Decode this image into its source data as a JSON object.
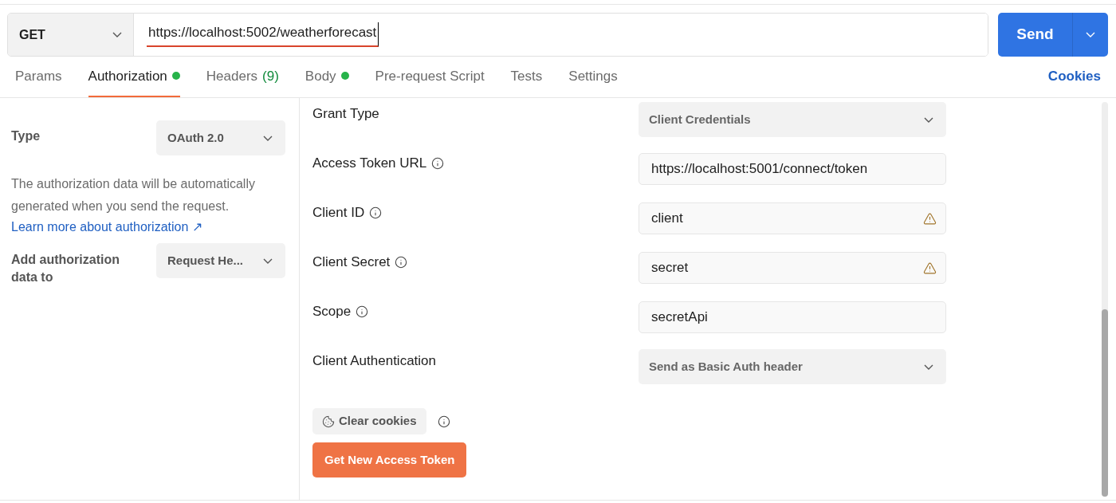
{
  "request": {
    "method": "GET",
    "url": "https://localhost:5002/weatherforecast",
    "send": "Send"
  },
  "tabs": [
    {
      "label": "Params",
      "selected": false,
      "dot": false
    },
    {
      "label": "Authorization",
      "selected": true,
      "dot": true
    },
    {
      "label": "Headers",
      "count": "(9)",
      "selected": false,
      "dot": false
    },
    {
      "label": "Body",
      "selected": false,
      "dot": true
    },
    {
      "label": "Pre-request Script",
      "selected": false,
      "dot": false
    },
    {
      "label": "Tests",
      "selected": false,
      "dot": false
    },
    {
      "label": "Settings",
      "selected": false,
      "dot": false
    }
  ],
  "cookies_link": "Cookies",
  "auth_panel": {
    "type_label": "Type",
    "type_value": "OAuth 2.0",
    "description": "The authorization data will be automatically generated when you send the request.",
    "learn_more": "Learn more about authorization ↗",
    "add_to_label": "Add authorization data to",
    "add_to_value": "Request He..."
  },
  "fields": [
    {
      "kind": "select",
      "label": "Grant Type",
      "value": "Client Credentials",
      "info": false,
      "warning": false
    },
    {
      "kind": "input",
      "label": "Access Token URL",
      "value": "https://localhost:5001/connect/token",
      "info": true,
      "warning": false
    },
    {
      "kind": "input",
      "label": "Client ID",
      "value": "client",
      "info": true,
      "warning": true
    },
    {
      "kind": "input",
      "label": "Client Secret",
      "value": "secret",
      "info": true,
      "warning": true
    },
    {
      "kind": "input",
      "label": "Scope",
      "value": "secretApi",
      "info": true,
      "warning": false
    },
    {
      "kind": "select",
      "label": "Client Authentication",
      "value": "Send as Basic Auth header",
      "info": false,
      "warning": false
    }
  ],
  "clear_cookies": "Clear cookies",
  "get_token": "Get New Access Token"
}
